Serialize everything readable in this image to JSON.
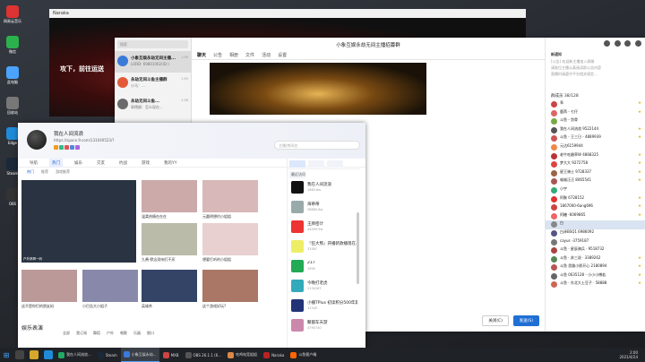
{
  "desktop": {
    "icons": [
      {
        "label": "网易云音乐",
        "color": "#d33"
      },
      {
        "label": "微信",
        "color": "#2bb24c"
      },
      {
        "label": "此电脑",
        "color": "#4aa3ff"
      },
      {
        "label": "回收站",
        "color": "#777"
      },
      {
        "label": "Edge",
        "color": "#1f8bd8"
      },
      {
        "label": "Steam",
        "color": "#1b2838"
      },
      {
        "label": "OBS",
        "color": "#333"
      }
    ]
  },
  "video_window": {
    "title": "Naraka",
    "overlay_text": "攻下，前往运送"
  },
  "chat": {
    "search_placeholder": "搜索",
    "conversations": [
      {
        "name": "小象互娱永劫无间主播...",
        "msg": "LORD: 69801002(ID:)",
        "time": "1:59",
        "color": "#3a7ad9"
      },
      {
        "name": "永劫无间斗鱼主播群",
        "msg": "小马：...",
        "time": "1:59",
        "color": "#e35a3a"
      },
      {
        "name": "永劫无间斗鱼...",
        "msg": "郭德纲：怎么现在...",
        "time": "1:58",
        "color": "#6b6b6b"
      }
    ],
    "title": "小象互娱永劫无间主播招募群",
    "tabs": [
      "聊天",
      "公告",
      "相册",
      "文件",
      "活动",
      "设置"
    ],
    "close_button": "关闭(C)",
    "send_button": "发送(S)",
    "notice_heading": "新通知",
    "notice_lines": [
      "[公告] 欢迎新主播加入群聊",
      "请各位主播认真阅读群公告内容",
      "直播时请遵守平台相关规定..."
    ],
    "member_title": "群成员 38/128",
    "members": [
      {
        "name": "乖",
        "color": "#c44",
        "star": true
      },
      {
        "name": "鹿苒 - 七仔",
        "color": "#d66",
        "star": true
      },
      {
        "name": "斗鱼 - 剑骨",
        "color": "#7a4",
        "star": false
      },
      {
        "name": "我在人间流浪 9522144",
        "color": "#555",
        "star": true
      },
      {
        "name": "斗鱼 - 王三日 - 4889939",
        "color": "#c55",
        "star": true
      },
      {
        "name": "元达6159944",
        "color": "#e84",
        "star": false
      },
      {
        "name": "老牛吃嫩草W 4868325",
        "color": "#b33",
        "star": true
      },
      {
        "name": "梦大大 9272758",
        "color": "#d44",
        "star": true
      },
      {
        "name": "星王骑士 9728337",
        "color": "#964",
        "star": true
      },
      {
        "name": "喵喵汪汪 8065541",
        "color": "#a55",
        "star": true
      },
      {
        "name": "小宇",
        "color": "#3a7",
        "star": false
      },
      {
        "name": "阿聚 6728152",
        "color": "#d33",
        "star": true
      },
      {
        "name": "1867000-6ang696",
        "color": "#c44",
        "star": true
      },
      {
        "name": "阿糖 -6069865",
        "color": "#e66",
        "star": true
      },
      {
        "name": "白",
        "color": "#888",
        "star": false
      },
      {
        "name": "白泽BSQ1 6986092",
        "color": "#558",
        "star": false
      },
      {
        "name": "cayus -3759187",
        "color": "#777",
        "star": false
      },
      {
        "name": "斗鱼 · 星辰骑兵 · 9518732",
        "color": "#a44",
        "star": false
      },
      {
        "name": "斗鱼 · 苏三说 · 3389262",
        "color": "#585",
        "star": true
      },
      {
        "name": "斗鱼 思路小胖开心 2180894",
        "color": "#b55",
        "star": true
      },
      {
        "name": "斗鱼 0635128 - 小小小傅若",
        "color": "#666",
        "star": true
      },
      {
        "name": "斗鱼 · 东北大土豆子 · 58888",
        "color": "#c65",
        "star": true
      }
    ]
  },
  "win9": {
    "user_name": "我在人间流浪",
    "url": "https://space.9.com/131040523/?",
    "search_placeholder": "主播/房间名",
    "nav": [
      "导航",
      "热门",
      "娱乐",
      "交友",
      "约战",
      "游戏",
      "我的YY"
    ],
    "sub": [
      "热门",
      "推荐",
      "游戏推荐"
    ],
    "tiles": [
      {
        "caption": "户外搞哥一码",
        "label": "户外搞哥一码",
        "color": "#2a3342"
      },
      {
        "caption": "",
        "label": "温柔热情在在在",
        "color": "#caa"
      },
      {
        "caption": "",
        "label": "元圆明想约小姐姐",
        "color": "#d8b8b8"
      },
      {
        "caption": "",
        "label": "九酱-默念双响打不厌",
        "color": "#bba"
      },
      {
        "caption": "",
        "label": "想要打听的小姐姐",
        "color": "#e8d0d0"
      },
      {
        "caption": "",
        "label": "这不是你们的朋友妈",
        "color": "#b99"
      },
      {
        "caption": "",
        "label": "小巴告大小姐子",
        "color": "#88a"
      },
      {
        "caption": "",
        "label": "英雄杀",
        "color": "#346"
      },
      {
        "caption": "",
        "label": "这个游戏好玩?",
        "color": "#a76"
      }
    ],
    "section_title": "娱乐表演",
    "section_tabs": [
      "全部",
      "我订阅",
      "舞蹈",
      "户外",
      "唱歌",
      "乐器",
      "脱口"
    ],
    "right_sub": "最近访问",
    "rooms": [
      {
        "name": "我在人间流浪",
        "count": "1660.6w",
        "color": "#111"
      },
      {
        "name": "海蒂蒂",
        "count": "38880.8w",
        "color": "#9aa"
      },
      {
        "name": "王牌密计",
        "count": "44990.9w",
        "color": "#e33"
      },
      {
        "name": "『狂大熊』开播新款播现在...江湖一路",
        "count": "33387",
        "color": "#ee6"
      },
      {
        "name": "217",
        "count": "1990",
        "color": "#2a5"
      },
      {
        "name": "今晚打老虎",
        "count": "2134187",
        "color": "#3ab"
      },
      {
        "name": "小播TPlus 初读积分500年期周赛",
        "count": "12345",
        "color": "#237"
      },
      {
        "name": "聚都车天游",
        "count": "4790740",
        "color": "#c8a"
      }
    ]
  },
  "taskbar": {
    "apps": [
      {
        "label": "我在人间流浪...",
        "color": "#2a6",
        "active": false
      },
      {
        "label": "Steam",
        "color": "#1b2838",
        "active": false
      },
      {
        "label": "小象互娱永劫...",
        "color": "#3a7ad9",
        "active": true
      },
      {
        "label": "MXB",
        "color": "#c44",
        "active": false
      },
      {
        "label": "OBS 26.1.1 (6...",
        "color": "#555",
        "active": false
      },
      {
        "label": "吃鸡电竞姐姐",
        "color": "#d84",
        "active": false
      },
      {
        "label": "Naraka",
        "color": "#b22",
        "active": false
      },
      {
        "label": "斗鱼客户端",
        "color": "#f60",
        "active": false
      }
    ],
    "time": "2:00",
    "date": "2021/4/24"
  }
}
